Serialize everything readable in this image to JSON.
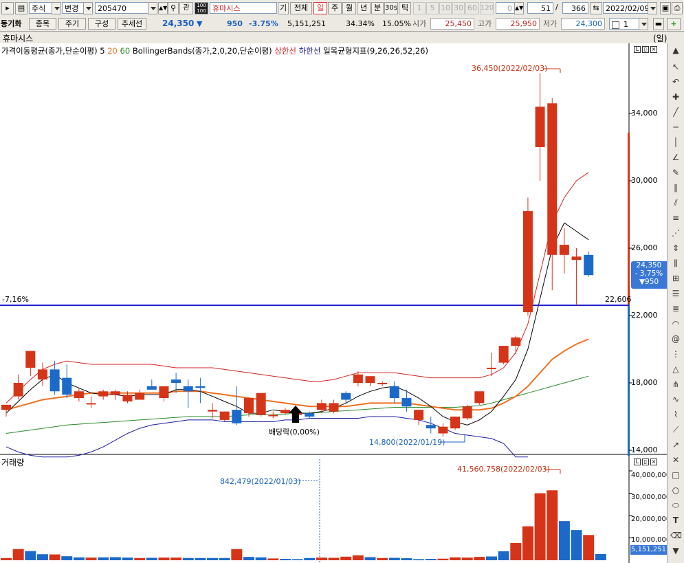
{
  "toolbar": {
    "market": "주식",
    "change_label": "변경",
    "code": "205470",
    "name": "휴마시스",
    "gi": "기",
    "all": "전체",
    "periods": [
      "일",
      "주",
      "월",
      "년",
      "분",
      "30s",
      "틱"
    ],
    "selected_period": "일",
    "tick_nums": [
      "1",
      "5",
      "10",
      "30",
      "60",
      "120"
    ],
    "zero": "0",
    "page": "51",
    "slash": "/",
    "total": "366",
    "date": "2022/02/09"
  },
  "quote": {
    "title": "동기화",
    "tabs": [
      "종목",
      "주기",
      "구성",
      "추세선"
    ],
    "price": "24,350",
    "arrow": "▼",
    "change": "950",
    "rate": "-3.75%",
    "volume": "5,151,251",
    "turnover": "34.34%",
    "pct2": "15.05%",
    "open_label": "시가",
    "open": "25,450",
    "high_label": "고가",
    "high": "25,950",
    "low_label": "저가",
    "low": "24,300",
    "count": "1"
  },
  "chart_title": "휴마시스",
  "unit": "(일)",
  "legend": {
    "ma_prefix": "가격이동평균(종가,단순이평)",
    "ma5": "5",
    "ma20": "20",
    "ma60": "60",
    "bb": "BollingerBands(종가,2,0,20,단순이평)",
    "bb_up": "상한선",
    "bb_down": "하한선",
    "ichimoku": "일목균형지표(9,26,26,52,26)"
  },
  "annotations": {
    "high_note": "36,450(2022/02/03)",
    "low_note": "14,800(2022/01/19)",
    "dividend": "배당락(0,00%)",
    "pct_line": "-7,16%",
    "line_value": "22,606",
    "cur_price": "24,350",
    "cur_rate": "- 3,75%",
    "cur_change": "▼950",
    "vol_high_note": "41,560,758(2022/02/03)",
    "vol_date_note": "842,479(2022/01/03)",
    "cur_vol": "5,151,251"
  },
  "volume_title": "거래량",
  "price_axis": [
    "34,000",
    "30,000",
    "26,000",
    "22,000",
    "18,000",
    "14,000"
  ],
  "volume_axis": [
    "40,000,000",
    "30,000,000",
    "20,000,000",
    "10,000,000"
  ],
  "colors": {
    "up": "#d63418",
    "down": "#1b6ac9",
    "ma5": "#000000",
    "ma20": "#f07020",
    "ma60": "#2a8a2a",
    "bb_upper": "#d62020",
    "bb_lower": "#1a1aa0",
    "hline": "#1a1ad0"
  },
  "chart_data": {
    "type": "candlestick",
    "candles": [
      [
        16.4,
        16.7,
        16.0,
        16.7
      ],
      [
        17.2,
        18.5,
        17.0,
        18.0
      ],
      [
        18.9,
        19.9,
        18.4,
        19.9
      ],
      [
        18.2,
        19.2,
        17.8,
        18.8
      ],
      [
        18.8,
        19.3,
        17.3,
        17.5
      ],
      [
        18.3,
        19.1,
        17.1,
        17.3
      ],
      [
        17.1,
        17.7,
        16.9,
        17.5
      ],
      [
        16.8,
        17.2,
        16.5,
        16.8
      ],
      [
        17.2,
        17.6,
        17.0,
        17.5
      ],
      [
        17.3,
        17.6,
        17.0,
        17.5
      ],
      [
        16.9,
        17.5,
        16.8,
        17.3
      ],
      [
        17.0,
        17.6,
        17.0,
        17.4
      ],
      [
        17.8,
        18.2,
        17.6,
        17.6
      ],
      [
        17.1,
        17.8,
        16.9,
        17.8
      ],
      [
        18.2,
        18.6,
        17.4,
        18.0
      ],
      [
        17.8,
        18.2,
        16.5,
        17.5
      ],
      [
        17.8,
        18.3,
        16.8,
        17.7
      ],
      [
        16.3,
        16.8,
        15.9,
        16.4
      ],
      [
        15.8,
        16.3,
        15.7,
        16.3
      ],
      [
        16.4,
        17.8,
        15.5,
        15.6
      ],
      [
        16.2,
        17.1,
        16.0,
        17.1
      ],
      [
        16.1,
        16.6,
        16.0,
        17.4
      ],
      [
        16.1,
        16.3,
        15.9,
        16.1
      ],
      [
        16.2,
        16.5,
        16.1,
        16.4
      ],
      [
        16.1,
        16.3,
        15.8,
        16.2
      ],
      [
        16.2,
        16.3,
        15.9,
        16.0
      ],
      [
        16.4,
        17.0,
        16.2,
        16.8
      ],
      [
        16.3,
        17.0,
        16.2,
        16.8
      ],
      [
        17.4,
        17.5,
        16.8,
        17.0
      ],
      [
        18.0,
        18.7,
        17.8,
        18.5
      ],
      [
        18.0,
        18.4,
        17.8,
        18.4
      ],
      [
        18.0,
        18.1,
        17.8,
        18.0
      ],
      [
        17.8,
        18.1,
        16.8,
        17.1
      ],
      [
        17.1,
        17.6,
        16.3,
        16.6
      ],
      [
        15.8,
        16.4,
        15.5,
        16.4
      ],
      [
        15.5,
        16.0,
        15.0,
        15.3
      ],
      [
        15.0,
        15.6,
        14.8,
        15.4
      ],
      [
        15.3,
        16.0,
        15.2,
        16.0
      ],
      [
        15.9,
        16.7,
        15.8,
        16.6
      ],
      [
        16.8,
        17.3,
        16.7,
        17.5
      ],
      [
        18.9,
        19.8,
        18.4,
        18.9
      ],
      [
        19.2,
        20.2,
        19.1,
        20.2
      ],
      [
        20.2,
        20.8,
        19.7,
        20.7
      ],
      [
        22.2,
        29.0,
        22.0,
        28.2
      ],
      [
        32.0,
        36.4,
        30.0,
        34.4
      ],
      [
        25.6,
        34.9,
        23.5,
        34.6
      ],
      [
        25.6,
        27.2,
        24.5,
        26.2
      ],
      [
        25.3,
        26.0,
        22.6,
        25.5
      ],
      [
        25.6,
        25.8,
        24.3,
        24.4
      ]
    ],
    "ma5": [
      16.2,
      16.9,
      17.6,
      18.2,
      18.5,
      18.0,
      17.7,
      17.4,
      17.3,
      17.3,
      17.2,
      17.3,
      17.3,
      17.3,
      17.6,
      17.6,
      17.5,
      17.2,
      16.9,
      16.6,
      16.2,
      16.2,
      16.4,
      16.3,
      16.2,
      16.2,
      16.3,
      16.5,
      16.8,
      17.2,
      17.5,
      17.7,
      17.8,
      17.5,
      17.1,
      16.6,
      16.0,
      15.7,
      15.5,
      15.8,
      16.3,
      17.2,
      18.2,
      20.0,
      23.0,
      26.0,
      27.5,
      27.0,
      26.5
    ],
    "ma20": [
      16.4,
      16.6,
      16.8,
      17.0,
      17.1,
      17.2,
      17.3,
      17.4,
      17.4,
      17.4,
      17.4,
      17.4,
      17.4,
      17.4,
      17.5,
      17.5,
      17.5,
      17.4,
      17.3,
      17.2,
      17.1,
      17.0,
      16.9,
      16.8,
      16.7,
      16.6,
      16.6,
      16.6,
      16.6,
      16.7,
      16.8,
      16.8,
      16.8,
      16.8,
      16.7,
      16.6,
      16.5,
      16.4,
      16.4,
      16.4,
      16.5,
      16.8,
      17.2,
      17.8,
      18.6,
      19.4,
      19.9,
      20.3,
      20.6
    ],
    "ma60": [
      15.0,
      15.1,
      15.2,
      15.3,
      15.4,
      15.5,
      15.55,
      15.6,
      15.65,
      15.7,
      15.75,
      15.8,
      15.85,
      15.9,
      15.95,
      16.0,
      16.0,
      16.0,
      16.0,
      16.05,
      16.1,
      16.1,
      16.1,
      16.15,
      16.2,
      16.2,
      16.25,
      16.3,
      16.35,
      16.4,
      16.45,
      16.5,
      16.55,
      16.55,
      16.55,
      16.55,
      16.55,
      16.55,
      16.6,
      16.65,
      16.8,
      17.0,
      17.2,
      17.4,
      17.6,
      17.8,
      18.0,
      18.2,
      18.4
    ],
    "bb_upper": [
      16.8,
      17.5,
      18.2,
      18.8,
      19.1,
      19.3,
      19.2,
      19.1,
      19.1,
      19.1,
      19.1,
      19.1,
      19.1,
      19.0,
      18.9,
      18.9,
      18.9,
      18.9,
      18.8,
      18.7,
      18.6,
      18.5,
      18.4,
      18.3,
      18.2,
      18.1,
      18.1,
      18.2,
      18.4,
      18.6,
      18.6,
      18.6,
      18.6,
      18.5,
      18.4,
      18.3,
      18.3,
      18.3,
      18.3,
      18.3,
      18.5,
      18.9,
      19.8,
      21.5,
      24.5,
      27.5,
      29.0,
      30.0,
      30.5
    ],
    "bb_lower": [
      14.2,
      13.9,
      13.7,
      13.6,
      13.6,
      13.6,
      13.7,
      13.9,
      14.2,
      14.6,
      15.0,
      15.3,
      15.5,
      15.6,
      15.7,
      15.8,
      15.8,
      15.8,
      15.7,
      15.7,
      15.7,
      15.7,
      15.7,
      15.8,
      15.8,
      15.9,
      15.9,
      15.9,
      15.9,
      15.9,
      16.0,
      16.0,
      16.0,
      15.9,
      15.8,
      15.6,
      15.3,
      15.0,
      14.9,
      14.8,
      14.7,
      14.4,
      13.6,
      12.0,
      9.0,
      6.0,
      4.5,
      3.5,
      2.8
    ],
    "volume": [
      1.0,
      5.0,
      4.1,
      2.7,
      2.6,
      1.8,
      1.3,
      1.2,
      1.3,
      1.4,
      1.2,
      1.0,
      1.1,
      1.2,
      1.2,
      1.0,
      1.0,
      1.0,
      1.0,
      5.0,
      1.5,
      1.3,
      0.8,
      0.6,
      0.5,
      1.0,
      1.2,
      1.1,
      1.6,
      2.2,
      1.4,
      1.0,
      1.1,
      0.9,
      0.5,
      0.6,
      0.7,
      1.3,
      1.2,
      1.5,
      1.7,
      4.0,
      7.7,
      15.2,
      30.0,
      31.3,
      17.5,
      13.5,
      11.3,
      2.8
    ],
    "volume_up": [
      1,
      1,
      0,
      0,
      1,
      0,
      0,
      1,
      0,
      0,
      0,
      1,
      0,
      1,
      1,
      0,
      0,
      0,
      0,
      1,
      0,
      0,
      1,
      0,
      0,
      0,
      1,
      1,
      1,
      1,
      0,
      1,
      0,
      0,
      0,
      0,
      1,
      1,
      1,
      1,
      0,
      0,
      1,
      1,
      1,
      1,
      0,
      0,
      1,
      0
    ],
    "price_range": [
      13500,
      37500
    ],
    "volume_range": [
      0,
      45000000
    ],
    "high_close_level": 22606
  }
}
